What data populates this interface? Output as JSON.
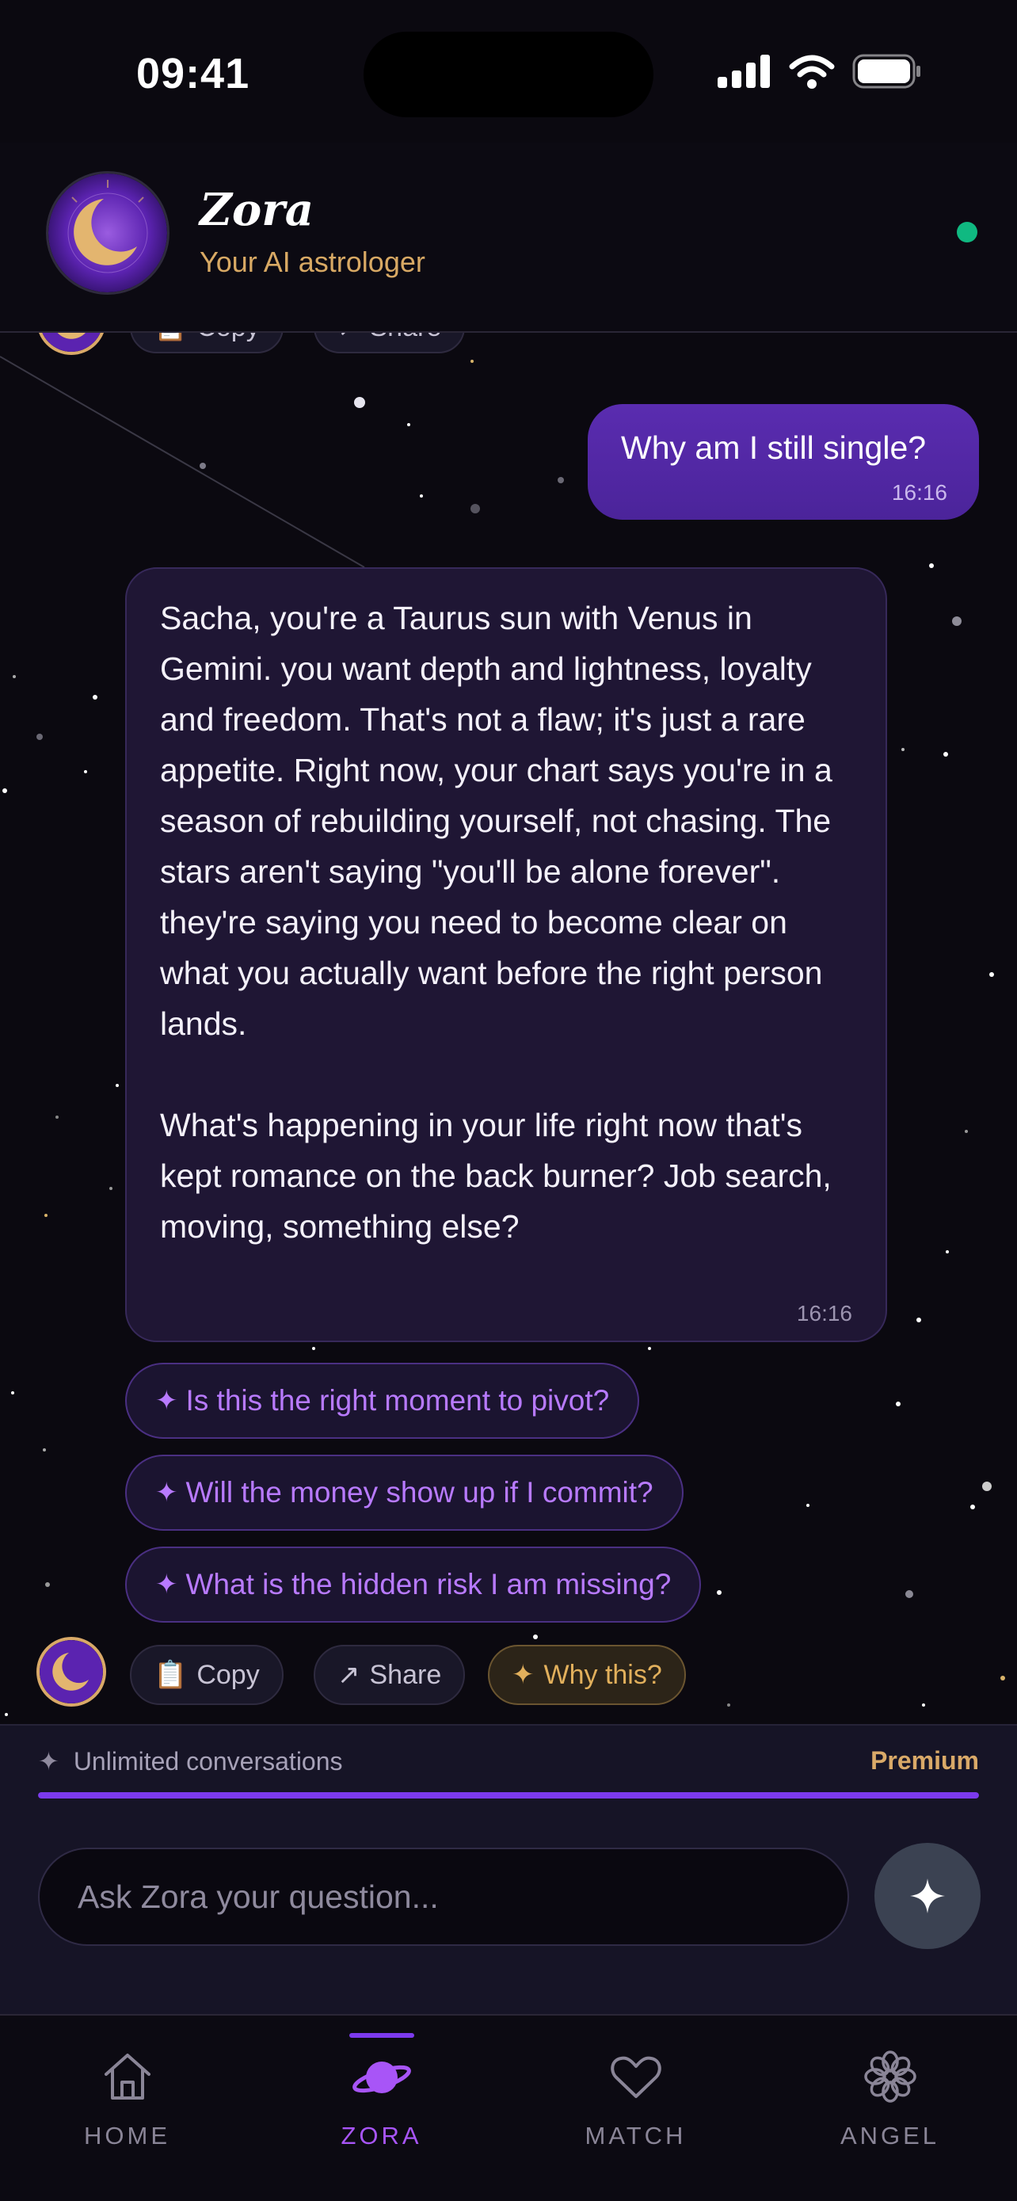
{
  "status_bar": {
    "time": "09:41"
  },
  "header": {
    "title": "Zora",
    "subtitle": "Your AI astrologer",
    "online_color": "#10b981"
  },
  "previous_actions": {
    "copy_label": "Copy",
    "share_label": "Share"
  },
  "messages": [
    {
      "role": "user",
      "text": "Why am I still single?",
      "time": "16:16"
    },
    {
      "role": "assistant",
      "text": "Sacha, you're a Taurus sun with Venus in Gemini. you want depth and lightness, loyalty and freedom. That's not a flaw; it's just a rare appetite. Right now, your chart says you're in a season of rebuilding yourself, not chasing. The stars aren't saying \"you'll be alone forever\". they're saying you need to become clear on what you actually want before the right person lands.\n\nWhat's happening in your life right now that's kept romance on the back burner? Job search, moving, something else?",
      "time": "16:16"
    }
  ],
  "suggestions": [
    {
      "icon": "sparkle-icon",
      "label": "Is this the right moment to pivot?"
    },
    {
      "icon": "sparkle-icon",
      "label": "Will the money show up if I commit?"
    },
    {
      "icon": "sparkle-icon",
      "label": "What is the hidden risk I am missing?"
    }
  ],
  "actions": {
    "copy_label": "Copy",
    "share_label": "Share",
    "why_label": "Why this?"
  },
  "premium": {
    "label": "Unlimited conversations",
    "badge": "Premium",
    "progress": 1.0
  },
  "input": {
    "placeholder": "Ask Zora your question..."
  },
  "tabs": [
    {
      "label": "HOME",
      "icon": "home-icon",
      "active": false
    },
    {
      "label": "ZORA",
      "icon": "planet-icon",
      "active": true
    },
    {
      "label": "MATCH",
      "icon": "heart-icon",
      "active": false
    },
    {
      "label": "ANGEL",
      "icon": "flower-icon",
      "active": false
    }
  ],
  "colors": {
    "accent": "#7c3aed",
    "gold": "#d9a968",
    "background": "#0b0910"
  }
}
